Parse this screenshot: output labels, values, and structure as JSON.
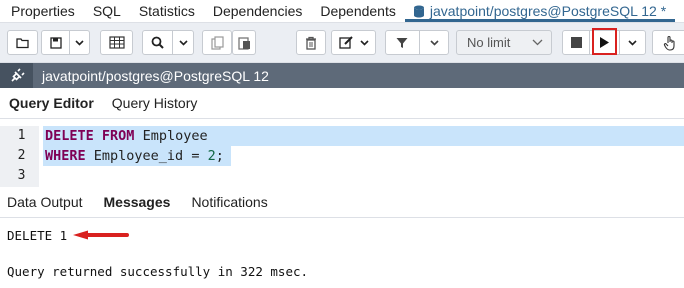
{
  "tabs": [
    {
      "label": "Properties"
    },
    {
      "label": "SQL"
    },
    {
      "label": "Statistics"
    },
    {
      "label": "Dependencies"
    },
    {
      "label": "Dependents"
    }
  ],
  "active_tab": {
    "label": "javatpoint/postgres@PostgreSQL 12 *",
    "icon": "database-icon"
  },
  "toolbar": {
    "buttons": [
      "folder-icon",
      "save-icon",
      "chevron-down-icon",
      "find-grid-icon",
      "search-icon",
      "chevron-down-icon",
      "copy-icon",
      "paste-icon",
      "delete-icon",
      "edit-icon",
      "chevron-down-icon",
      "filter-icon",
      "chevron-down-icon",
      "stop-icon",
      "execute-icon",
      "chevron-down-icon",
      "hand-icon"
    ],
    "limit_label": "No limit",
    "highlight_color": "#d9211f"
  },
  "connection": {
    "label": "javatpoint/postgres@PostgreSQL 12",
    "icon": "plug-icon"
  },
  "query_tabs": [
    {
      "label": "Query Editor"
    },
    {
      "label": "Query History"
    }
  ],
  "editor": {
    "line_numbers": [
      "1",
      "2",
      "3"
    ],
    "line1": {
      "kw1": "DELETE",
      "kw2": "FROM",
      "rest": "Employee"
    },
    "line2": {
      "kw": "WHERE",
      "mid": "Employee_id = ",
      "num": "2",
      "end": ";"
    }
  },
  "output_tabs": [
    {
      "label": "Data Output"
    },
    {
      "label": "Messages"
    },
    {
      "label": "Notifications"
    }
  ],
  "messages": {
    "result": "DELETE 1",
    "status": "Query returned successfully in 322 msec."
  },
  "colors": {
    "accent": "#326690",
    "selection": "#c9e4fb",
    "annotation_arrow": "#d9211f"
  }
}
